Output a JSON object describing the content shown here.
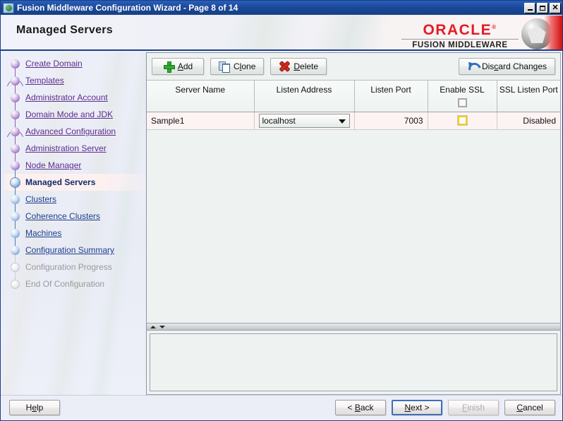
{
  "window": {
    "title": "Fusion Middleware Configuration Wizard - Page 8 of 14",
    "icon": "globe-icon",
    "minimize_label": "",
    "maximize_label": "",
    "close_label": "✕"
  },
  "banner": {
    "page_title": "Managed Servers",
    "brand": "ORACLE",
    "brand_mark": "®",
    "product": "FUSION MIDDLEWARE"
  },
  "sidebar": {
    "items": [
      {
        "label": "Create Domain",
        "state": "done"
      },
      {
        "label": "Templates",
        "state": "done"
      },
      {
        "label": "Administrator Account",
        "state": "done"
      },
      {
        "label": "Domain Mode and JDK",
        "state": "done"
      },
      {
        "label": "Advanced Configuration",
        "state": "done"
      },
      {
        "label": "Administration Server",
        "state": "done"
      },
      {
        "label": "Node Manager",
        "state": "done"
      },
      {
        "label": "Managed Servers",
        "state": "current"
      },
      {
        "label": "Clusters",
        "state": "todo"
      },
      {
        "label": "Coherence Clusters",
        "state": "todo"
      },
      {
        "label": "Machines",
        "state": "todo"
      },
      {
        "label": "Configuration Summary",
        "state": "todo"
      },
      {
        "label": "Configuration Progress",
        "state": "future"
      },
      {
        "label": "End Of Configuration",
        "state": "future"
      }
    ]
  },
  "toolbar": {
    "add": {
      "label_pre": "",
      "label_mn": "A",
      "label_post": "dd",
      "icon": "plus-icon"
    },
    "clone": {
      "label_pre": "C",
      "label_mn": "l",
      "label_post": "one",
      "icon": "copy-icon"
    },
    "delete": {
      "label_pre": "",
      "label_mn": "D",
      "label_post": "elete",
      "icon": "delete-x-icon"
    },
    "discard": {
      "label_pre": "Dis",
      "label_mn": "c",
      "label_post": "ard Changes",
      "icon": "undo-icon"
    }
  },
  "table": {
    "columns": [
      "Server Name",
      "Listen Address",
      "Listen Port",
      "Enable SSL",
      "SSL Listen Port"
    ],
    "header_ssl_checkbox": "unchecked",
    "rows": [
      {
        "server_name": "Sample1",
        "listen_address": "localhost",
        "listen_port": "7003",
        "enable_ssl": "unchecked",
        "ssl_listen_port": "Disabled"
      }
    ]
  },
  "footer": {
    "help": {
      "label_pre": "H",
      "label_mn": "e",
      "label_post": "lp"
    },
    "back": {
      "label_pre": "< ",
      "label_mn": "B",
      "label_post": "ack"
    },
    "next": {
      "label_pre": "",
      "label_mn": "N",
      "label_post": "ext >"
    },
    "finish": {
      "label_pre": "",
      "label_mn": "F",
      "label_post": "inish"
    },
    "cancel": {
      "label_pre": "",
      "label_mn": "C",
      "label_post": "ancel"
    }
  },
  "colors": {
    "titlebar": "#1a4899",
    "brand_red": "#e31b23",
    "link_purple": "#5b2d8e",
    "link_blue": "#1c3f8f",
    "current_text": "#132a6b",
    "focus_border": "#3d6fb5",
    "checkbox_focus": "#f2d000"
  }
}
